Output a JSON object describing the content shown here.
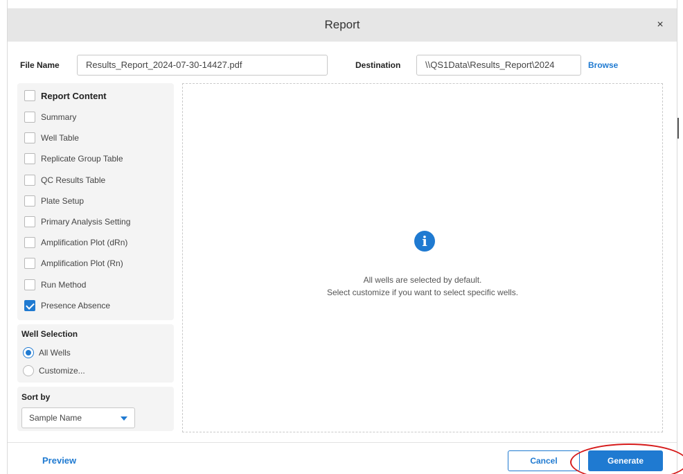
{
  "dialog": {
    "title": "Report",
    "close_glyph": "×"
  },
  "file": {
    "name_label": "File Name",
    "name_value": "Results_Report_2024-07-30-14427.pdf",
    "dest_label": "Destination",
    "dest_value": "\\\\QS1Data\\Results_Report\\2024",
    "browse_label": "Browse"
  },
  "report_content": {
    "header": "Report Content",
    "items": [
      {
        "label": "Summary",
        "checked": false
      },
      {
        "label": "Well Table",
        "checked": false
      },
      {
        "label": "Replicate Group Table",
        "checked": false
      },
      {
        "label": "QC Results Table",
        "checked": false
      },
      {
        "label": "Plate Setup",
        "checked": false
      },
      {
        "label": "Primary Analysis Setting",
        "checked": false
      },
      {
        "label": "Amplification Plot (dRn)",
        "checked": false
      },
      {
        "label": "Amplification Plot (Rn)",
        "checked": false
      },
      {
        "label": "Run Method",
        "checked": false
      },
      {
        "label": "Presence Absence",
        "checked": true
      }
    ]
  },
  "well_selection": {
    "title": "Well Selection",
    "options": [
      {
        "label": "All Wells",
        "selected": true
      },
      {
        "label": "Customize...",
        "selected": false
      }
    ]
  },
  "sort_by": {
    "title": "Sort by",
    "value": "Sample Name"
  },
  "preview_area": {
    "icon": "info-icon",
    "line1": "All wells are selected by default.",
    "line2": "Select customize if you want to select specific wells."
  },
  "footer": {
    "preview_label": "Preview",
    "cancel_label": "Cancel",
    "generate_label": "Generate"
  },
  "colors": {
    "accent": "#1f7ad1",
    "annotation": "#d61a1a",
    "titlebar": "#e6e6e6"
  }
}
